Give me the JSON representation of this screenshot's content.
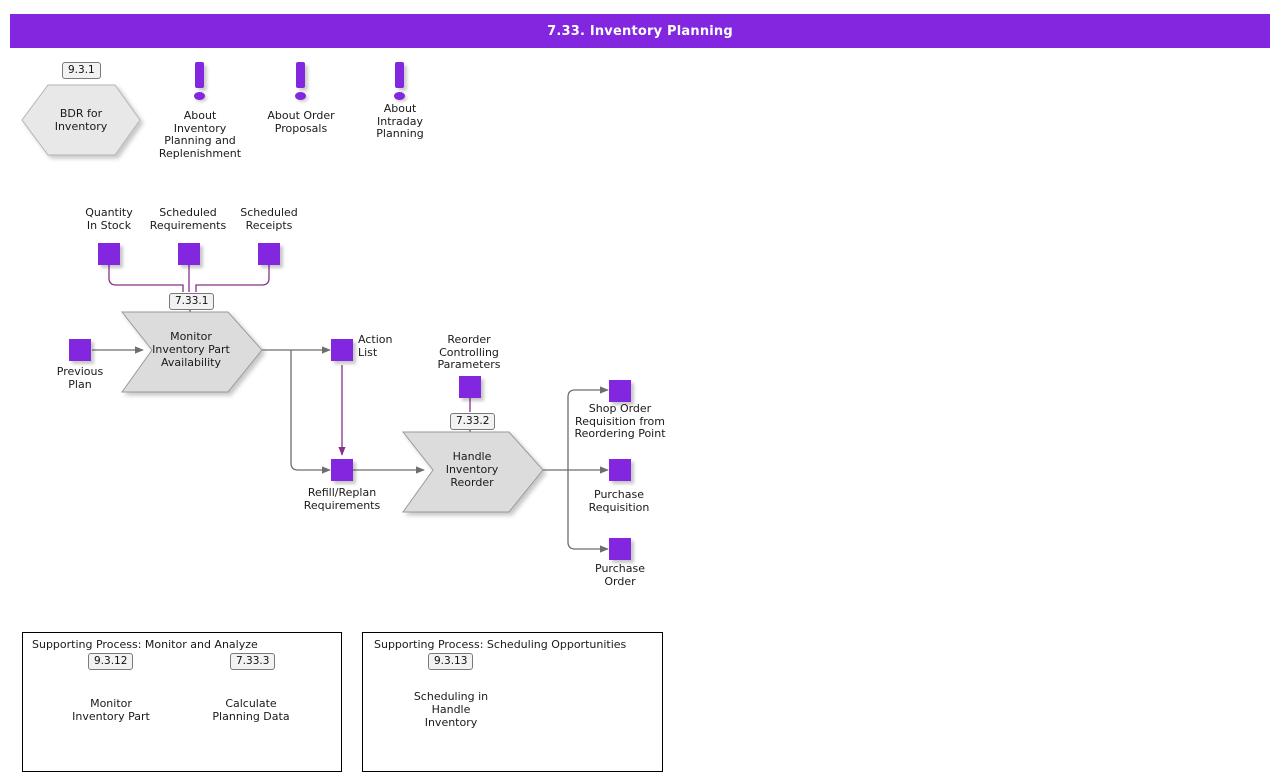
{
  "header": {
    "title": "7.33. Inventory Planning",
    "bar_color": "#8226e0"
  },
  "colors": {
    "accent_purple": "#8226e0",
    "shape_fill": "#dcdcdc",
    "shape_stroke": "#9a9a9a",
    "connector_gray": "#6e6e6e",
    "connector_purple": "#8a2f8a"
  },
  "top_row": {
    "bdr": {
      "id": "9.3.1",
      "label": "BDR for\nInventory",
      "shape": "hexagon"
    },
    "notes": [
      {
        "icon": "exclamation-note-icon",
        "label": "About\nInventory\nPlanning and\nReplenishment"
      },
      {
        "icon": "exclamation-note-icon",
        "label": "About Order\nProposals"
      },
      {
        "icon": "exclamation-note-icon",
        "label": "About\nIntraday\nPlanning"
      }
    ]
  },
  "inputs_top": [
    {
      "label": "Quantity\nIn Stock"
    },
    {
      "label": "Scheduled\nRequirements"
    },
    {
      "label": "Scheduled\nReceipts"
    }
  ],
  "activities": [
    {
      "id": "7.33.1",
      "label": "Monitor\nInventory Part\nAvailability",
      "shape": "chevron"
    },
    {
      "id": "7.33.2",
      "label": "Handle\nInventory\nReorder",
      "shape": "chevron"
    }
  ],
  "io_objects": {
    "previous_plan": "Previous\nPlan",
    "action_list": "Action\nList",
    "refill_replan": "Refill/Replan\nRequirements",
    "reorder_params": "Reorder\nControlling\nParameters",
    "shop_order_req": "Shop Order\nRequisition from\nReordering Point",
    "purchase_req": "Purchase\nRequisition",
    "purchase_order": "Purchase\nOrder"
  },
  "supporting_processes": [
    {
      "title": "Supporting Process: Monitor and Analyze",
      "activities": [
        {
          "id": "9.3.12",
          "label": "Monitor\nInventory Part"
        },
        {
          "id": "7.33.3",
          "label": "Calculate\nPlanning Data"
        }
      ]
    },
    {
      "title": "Supporting Process: Scheduling Opportunities",
      "activities": [
        {
          "id": "9.3.13",
          "label": "Scheduling in\nHandle\nInventory"
        }
      ]
    }
  ]
}
